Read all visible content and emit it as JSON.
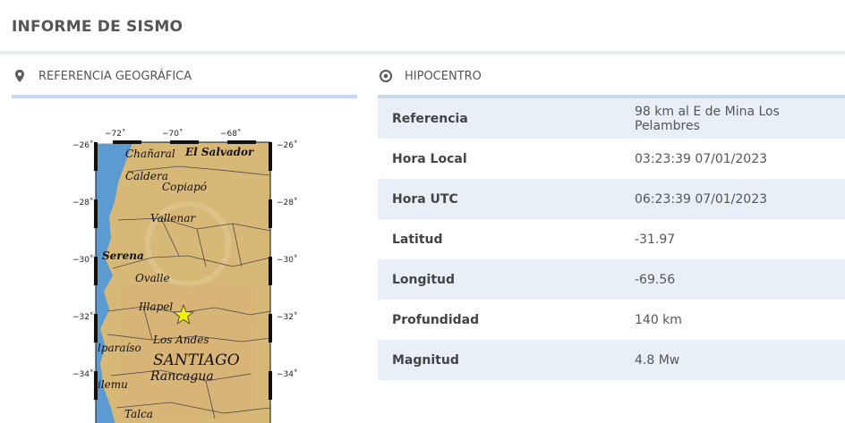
{
  "page": {
    "title": "INFORME DE SISMO"
  },
  "left_section": {
    "title": "REFERENCIA GEOGRÁFICA",
    "icon": "map-pin-icon"
  },
  "right_section": {
    "title": "HIPOCENTRO",
    "icon": "target-icon"
  },
  "map": {
    "lon_ticks": [
      "−72˚",
      "−70˚",
      "−68˚"
    ],
    "lat_ticks": [
      "−26˚",
      "−28˚",
      "−30˚",
      "−32˚",
      "−34˚"
    ],
    "places": {
      "chanaral": "Chañaral",
      "el_salvador": "El Salvador",
      "caldera": "Caldera",
      "copiapo": "Copiapó",
      "vallenar": "Vallenar",
      "serena": "Serena",
      "ovalle": "Ovalle",
      "illapel": "Illapel",
      "los_andes": "Los Andes",
      "valparaiso": "lparaíso",
      "santiago": "SANTIAGO",
      "rancagua": "Rancagua",
      "pichilemu": "ilemu",
      "talca": "Talca"
    },
    "colors": {
      "ocean": "#5b9bd1",
      "land": "#d8b877",
      "epicenter": "#f7f000"
    }
  },
  "hypocenter": {
    "rows": [
      {
        "label": "Referencia",
        "value": "98 km al E de Mina Los Pelambres"
      },
      {
        "label": "Hora Local",
        "value": "03:23:39 07/01/2023"
      },
      {
        "label": "Hora UTC",
        "value": "06:23:39 07/01/2023"
      },
      {
        "label": "Latitud",
        "value": "-31.97"
      },
      {
        "label": "Longitud",
        "value": "-69.56"
      },
      {
        "label": "Profundidad",
        "value": "140 km"
      },
      {
        "label": "Magnitud",
        "value": "4.8 Mw"
      }
    ]
  }
}
